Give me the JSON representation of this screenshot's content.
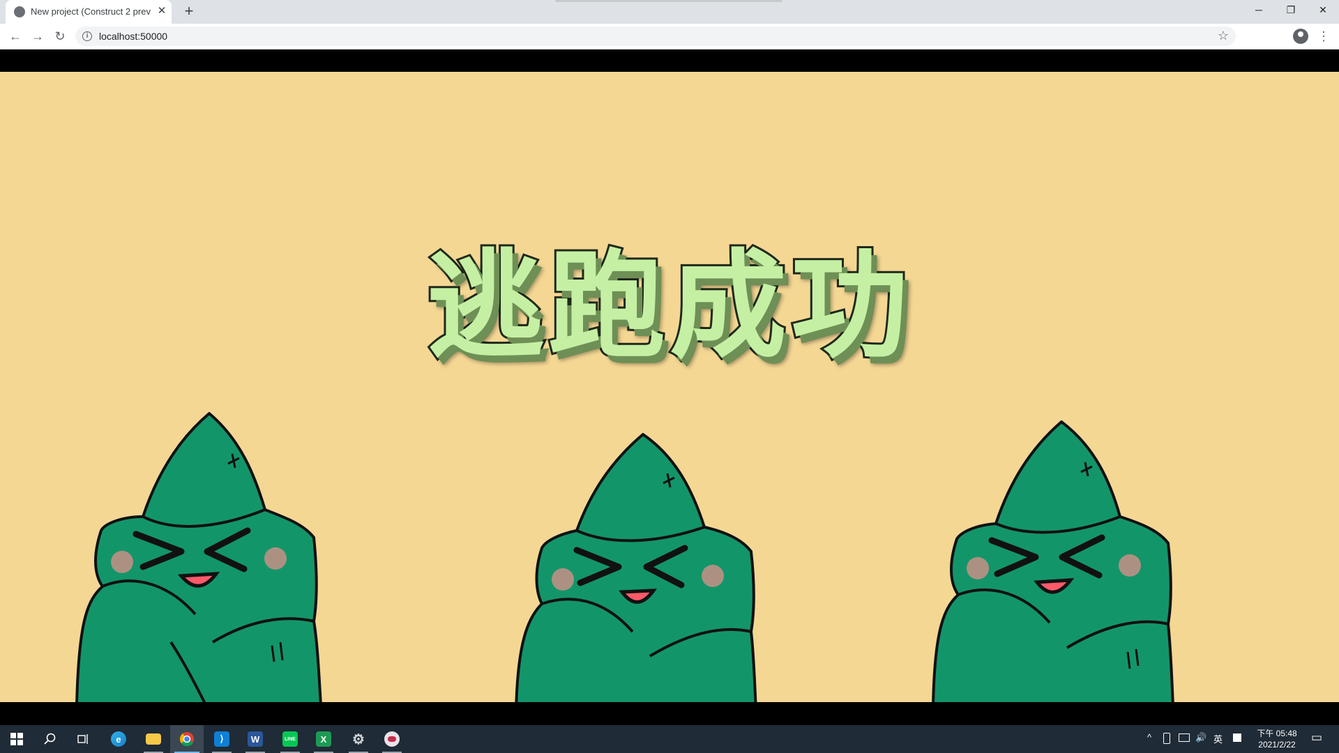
{
  "browser": {
    "tab_title": "New project (Construct 2 preview)",
    "tab_close": "✕",
    "new_tab": "+",
    "window_controls": {
      "minimize": "─",
      "restore": "❐",
      "close": "✕"
    },
    "nav": {
      "back": "←",
      "forward": "→",
      "reload": "↻"
    },
    "info_icon": "i",
    "url": "localhost:50000",
    "star": "☆",
    "menu": "⋮"
  },
  "game": {
    "headline": "逃跑成功",
    "colors": {
      "background": "#f5d794",
      "headline_fill": "#c5f0a4",
      "character": "#13956a"
    },
    "characters": [
      "bamboo-shoot-character",
      "bamboo-shoot-character",
      "bamboo-shoot-character"
    ]
  },
  "taskbar": {
    "apps": [
      {
        "name": "windows-start-icon"
      },
      {
        "name": "search-icon"
      },
      {
        "name": "task-view-icon"
      },
      {
        "name": "edge-icon",
        "label": "e"
      },
      {
        "name": "file-explorer-icon"
      },
      {
        "name": "chrome-icon"
      },
      {
        "name": "vscode-icon",
        "label": "⟩"
      },
      {
        "name": "word-icon",
        "label": "W"
      },
      {
        "name": "line-icon",
        "label": "LINE"
      },
      {
        "name": "excel-icon",
        "label": "X"
      },
      {
        "name": "settings-icon",
        "label": "⚙"
      },
      {
        "name": "construct-icon"
      }
    ],
    "tray": {
      "chevron": "^",
      "ime": "英",
      "volume": "🔊"
    },
    "clock": {
      "time": "下午 05:48",
      "date": "2021/2/22"
    },
    "notification": "▭"
  }
}
